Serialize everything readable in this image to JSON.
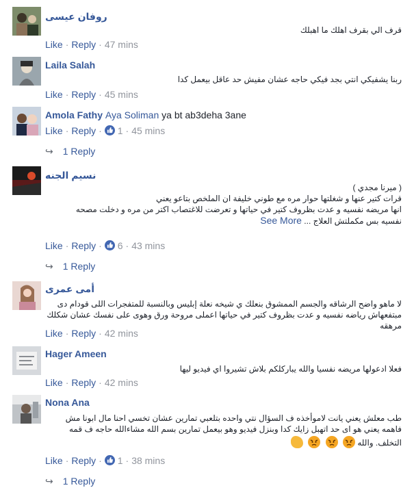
{
  "comments": [
    {
      "name": "روفان عيسى",
      "body": [
        "قرف الي بقرف اهلك ما اهبلك"
      ],
      "actions": {
        "like": "Like",
        "reply": "Reply",
        "time": "47 mins"
      }
    },
    {
      "name": "Laila Salah",
      "body": [
        "ربنا يشفيكي انتي بجد فيكي حاجه عشان مفيش حد عاقل بيعمل كدا"
      ],
      "actions": {
        "like": "Like",
        "reply": "Reply",
        "time": "45 mins"
      }
    },
    {
      "name": "Amola Fathy",
      "mention": "Aya Soliman",
      "inline_text": "ya bt ab3deha 3ane",
      "actions": {
        "like": "Like",
        "reply": "Reply",
        "likes": "1",
        "time": "45 mins"
      },
      "replies": "1 Reply"
    },
    {
      "name": "نسيم الجنه",
      "body": [
        "( ميرنا مجدي )",
        "قرات كتير عنها و شغلتها حوار مره مع طوني خليفة ان الملخص بتاعو يعني",
        "انها مريضه نفسيه و عدت بظروف كتير في حياتها و تعرضت للاغتصاب اكتر من مره و دخلت مصحه",
        "نفسيه بس مكملتش العلاج ..."
      ],
      "see_more": "See More",
      "actions": {
        "like": "Like",
        "reply": "Reply",
        "likes": "6",
        "time": "43 mins"
      },
      "replies": "1 Reply"
    },
    {
      "name": "أمى عمرى",
      "body": [
        "لا ماهو واضح الرشاقه والجسم الممشوق بنعلك ي شيخه نعلة إبليس وبالنسبة للمتفجرات اللى قودام دى",
        "مبتفعهاش رياضه نفسيه و عدت بظروف كتير في حياتها اعملى مروحة ورق وهوى على نفسك عشان شكلك مرهقه"
      ],
      "actions": {
        "like": "Like",
        "reply": "Reply",
        "time": "42 mins"
      }
    },
    {
      "name": "Hager Ameen",
      "body": [
        "فعلا ادعولها مريضه نفسيا والله يباركلكم بلاش تشيروا اي فيديو ليها"
      ],
      "actions": {
        "like": "Like",
        "reply": "Reply",
        "time": "42 mins"
      }
    },
    {
      "name": "Nona Ana",
      "body": [
        "طب معلش يعني يانت لاموأخذه ف السؤال نتي واحده بتلعبي تمارين عشان تخسي احنا مال ابونا مش",
        "فاهمه يعني هو اى حد اتهبل زايك كدا وبنزل فيديو وهو بيعمل تمارين بسم الله مشاءالله حاجه ف قمه",
        "التخلف. والله"
      ],
      "actions": {
        "like": "Like",
        "reply": "Reply",
        "likes": "1",
        "time": "38 mins"
      },
      "replies": "1 Reply"
    }
  ],
  "colors": {
    "link": "#365899",
    "meta": "#90949c",
    "text": "#1d2129",
    "like_badge": "#4267b2"
  },
  "icons": [
    "like-thumb-icon",
    "reply-arrow-icon",
    "angry-emoji-icon",
    "muscle-emoji-icon"
  ]
}
